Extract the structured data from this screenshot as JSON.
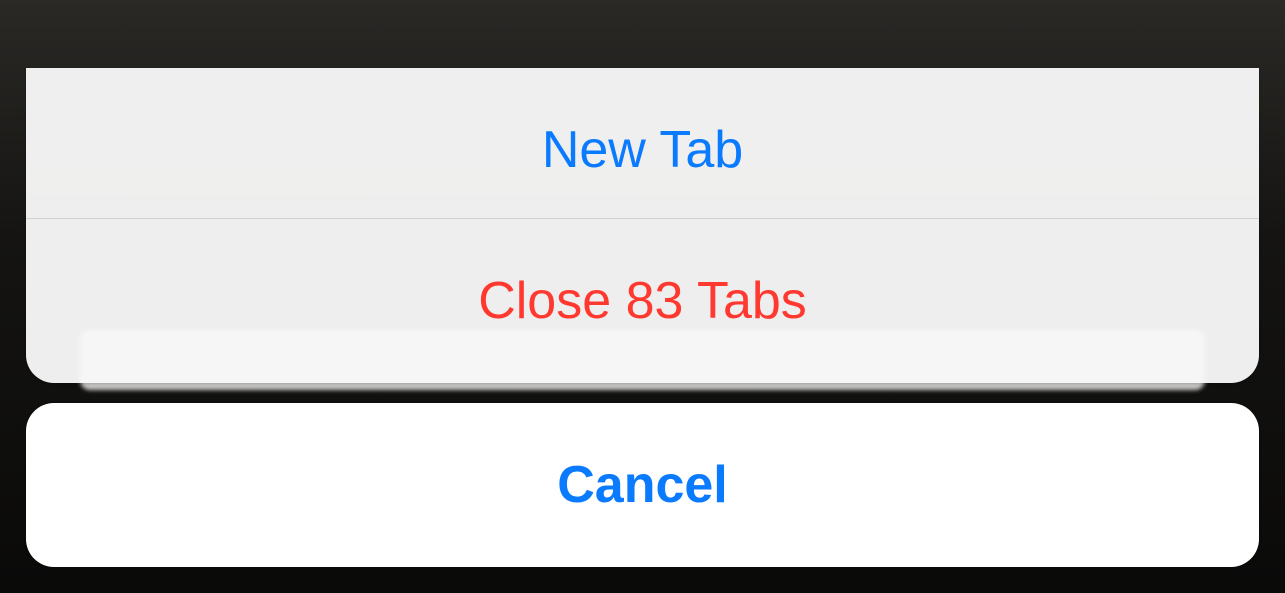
{
  "action_sheet": {
    "new_tab_label": "New Tab",
    "close_tabs_label": "Close 83 Tabs",
    "cancel_label": "Cancel",
    "tab_count": 83,
    "colors": {
      "primary": "#0a7aff",
      "destructive": "#ff3830"
    }
  }
}
